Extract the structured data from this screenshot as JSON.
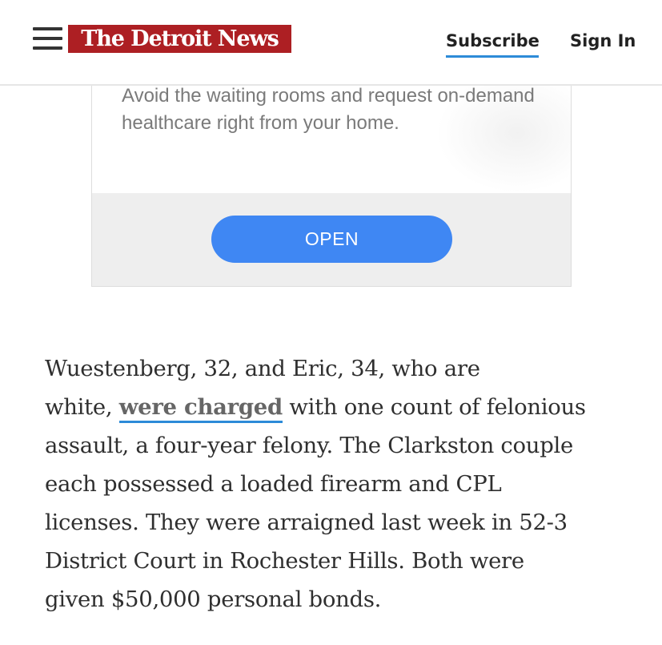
{
  "header": {
    "logo_text": "The Detroit News",
    "subscribe_label": "Subscribe",
    "signin_label": "Sign In",
    "menu_icon": "hamburger-icon",
    "logo_color": "#ad1f23",
    "accent_color": "#2d8bd8"
  },
  "ad": {
    "text": "Avoid the waiting rooms and request on-demand healthcare right from your home.",
    "button_label": "OPEN",
    "button_color": "#3f87f3"
  },
  "article": {
    "line1": "Wuestenberg, 32, and Eric, 34, who are",
    "line2_before": "white,",
    "link_text": "were charged",
    "line2_after": "with one count of felonious",
    "line3": "assault, a four-year felony. The Clarkston couple",
    "line4": "each possessed a loaded firearm and CPL",
    "line5": "licenses. They were arraigned last week in 52-3",
    "line6": "District Court in Rochester Hills. Both were",
    "line7": "given $50,000 personal bonds."
  }
}
